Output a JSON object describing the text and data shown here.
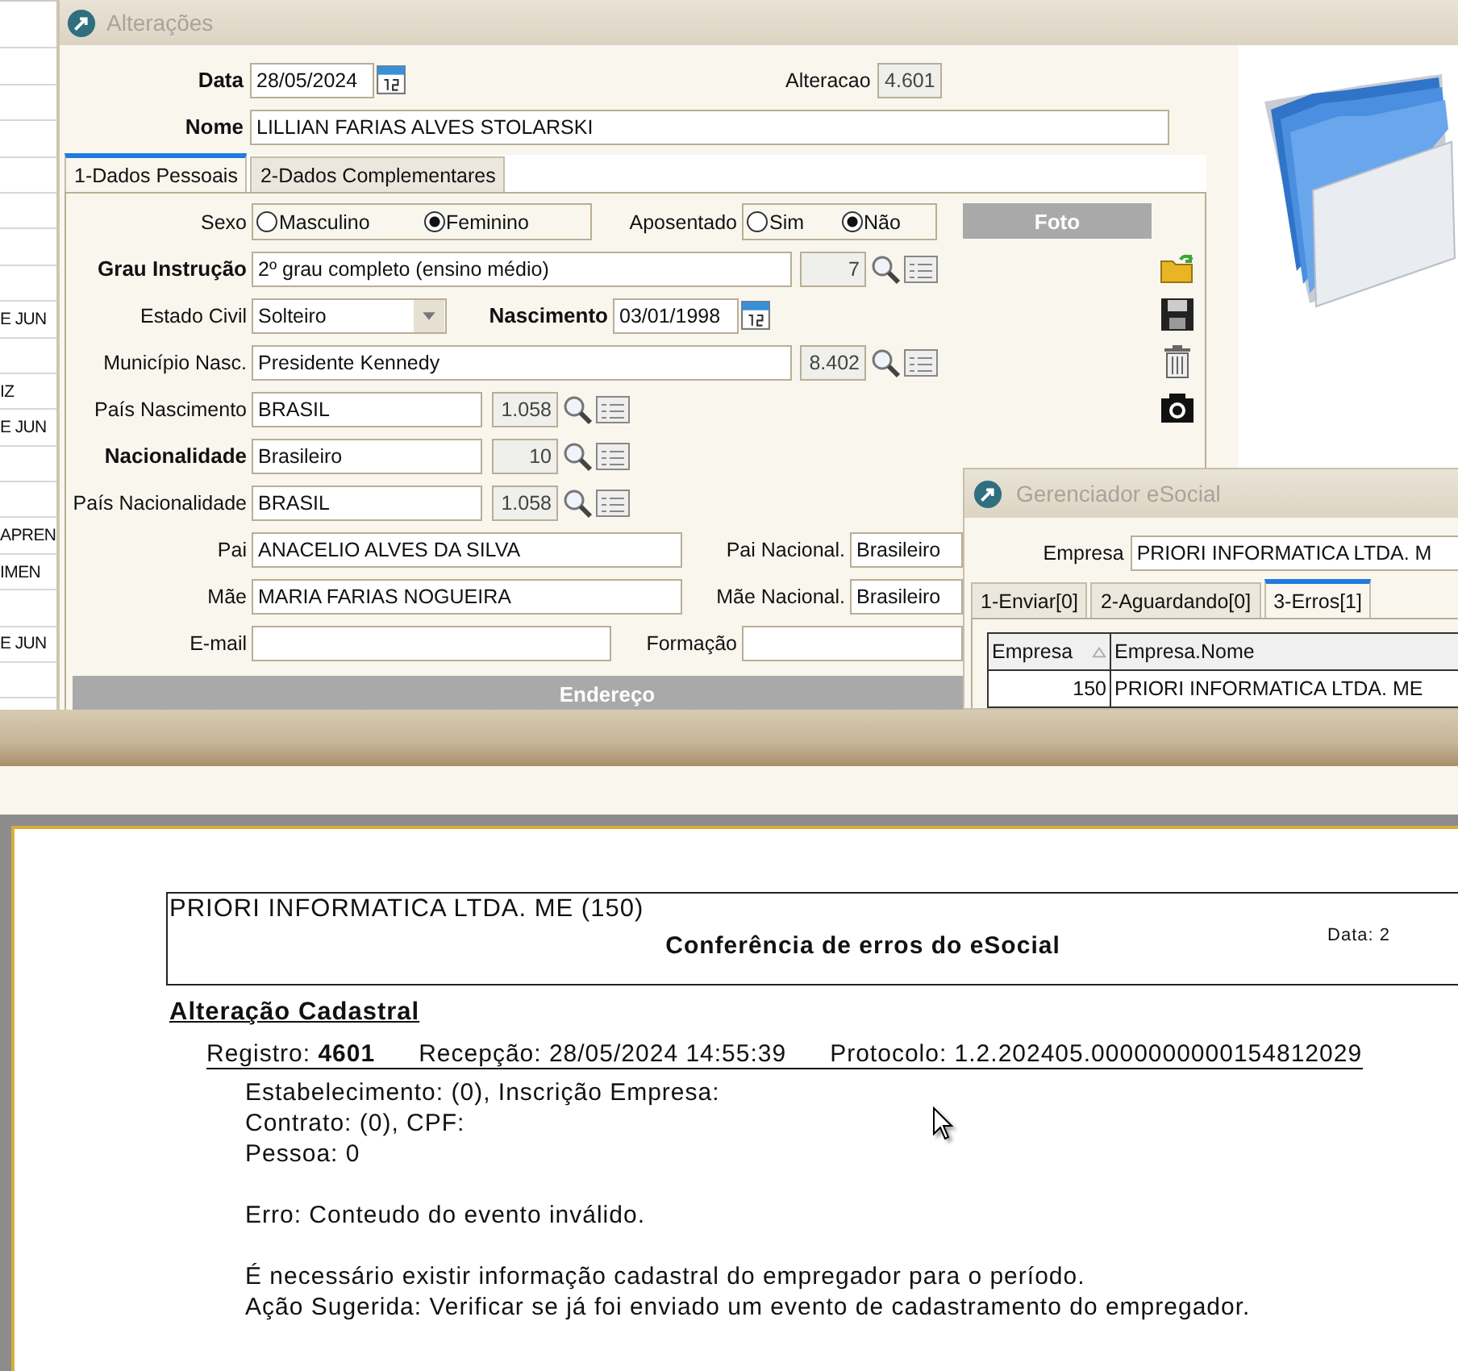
{
  "left_list": {
    "rows": [
      {},
      {},
      {},
      {},
      {},
      {},
      {},
      {},
      {
        "text": "E JUN"
      },
      {},
      {
        "text": "IZ"
      },
      {
        "text": "E JUN"
      },
      {},
      {},
      {
        "text": "APREN"
      },
      {
        "text": "IMEN"
      },
      {},
      {
        "text": "E JUN"
      },
      {}
    ]
  },
  "main_window": {
    "title": "Alterações",
    "data": {
      "label": "Data",
      "value": "28/05/2024"
    },
    "alteracao": {
      "label": "Alteracao",
      "value": "4.601"
    },
    "nome": {
      "label": "Nome",
      "value": "LILLIAN FARIAS ALVES STOLARSKI"
    },
    "tabs": [
      {
        "label": "1-Dados Pessoais",
        "selected": true
      },
      {
        "label": "2-Dados Complementares",
        "selected": false
      }
    ],
    "foto": "Foto",
    "rows": [
      {
        "kind": "radios",
        "groups": [
          {
            "label": "Sexo",
            "options": [
              {
                "label": "Masculino",
                "selected": false
              },
              {
                "label": "Feminino",
                "selected": true
              }
            ]
          },
          {
            "label": "Aposentado",
            "options": [
              {
                "label": "Sim",
                "selected": false
              },
              {
                "label": "Não",
                "selected": true
              }
            ]
          }
        ]
      },
      {
        "kind": "longlookup",
        "label": "Grau Instrução",
        "required": true,
        "value": "2º grau completo (ensino médio)",
        "code": "7"
      },
      {
        "kind": "combodate",
        "label": "Estado Civil",
        "required": false,
        "value": "Solteiro",
        "date_label": "Nascimento",
        "date_required": true,
        "date": "03/01/1998"
      },
      {
        "kind": "longlookup",
        "label": "Município Nasc.",
        "required": false,
        "value": "Presidente Kennedy",
        "code": "8.402"
      },
      {
        "kind": "lookup",
        "label": "País Nascimento",
        "required": false,
        "value": "BRASIL",
        "code": "1.058"
      },
      {
        "kind": "lookup",
        "label": "Nacionalidade",
        "required": true,
        "value": "Brasileiro",
        "code": "10"
      },
      {
        "kind": "lookup",
        "label": "País Nacionalidade",
        "required": false,
        "value": "BRASIL",
        "code": "1.058"
      },
      {
        "kind": "pair",
        "label": "Pai",
        "value": "ANACELIO ALVES DA SILVA",
        "label2": "Pai Nacional.",
        "value2": "Brasileiro"
      },
      {
        "kind": "pair",
        "label": "Mãe",
        "value": "MARIA FARIAS NOGUEIRA",
        "label2": "Mãe Nacional.",
        "value2": "Brasileiro"
      },
      {
        "kind": "contact",
        "label": "E-mail",
        "label2": "Formação"
      }
    ],
    "section": "Endereço"
  },
  "esocial_window": {
    "title": "Gerenciador eSocial",
    "empresa": {
      "label": "Empresa",
      "value": "PRIORI INFORMATICA LTDA. M"
    },
    "tabs": [
      {
        "label": "1-Enviar[0]",
        "selected": false
      },
      {
        "label": "2-Aguardando[0]",
        "selected": false
      },
      {
        "label": "3-Erros[1]",
        "selected": true
      }
    ],
    "table": {
      "columns": [
        "Empresa",
        "Empresa.Nome"
      ],
      "rows": [
        [
          "150",
          "PRIORI INFORMATICA LTDA. ME"
        ]
      ]
    }
  },
  "report": {
    "company": "PRIORI INFORMATICA LTDA. ME (150)",
    "date": "Data: 2",
    "title": "Conferência de erros do eSocial",
    "section": "Alteração Cadastral",
    "summary": [
      "Registro: **4601**",
      "Recepção: 28/05/2024 14:55:39",
      "Protocolo: 1.2.202405.0000000000154812029"
    ],
    "details": [
      "Estabelecimento:  (0), Inscrição Empresa:",
      "Contrato:  (0), CPF:",
      "Pessoa: 0"
    ],
    "error": "Erro: Conteudo do evento inválido.",
    "messages": [
      "É necessário existir informação cadastral do empregador para o período.",
      "Ação Sugerida: Verificar se já foi enviado um evento de cadastramento do empregador."
    ]
  }
}
